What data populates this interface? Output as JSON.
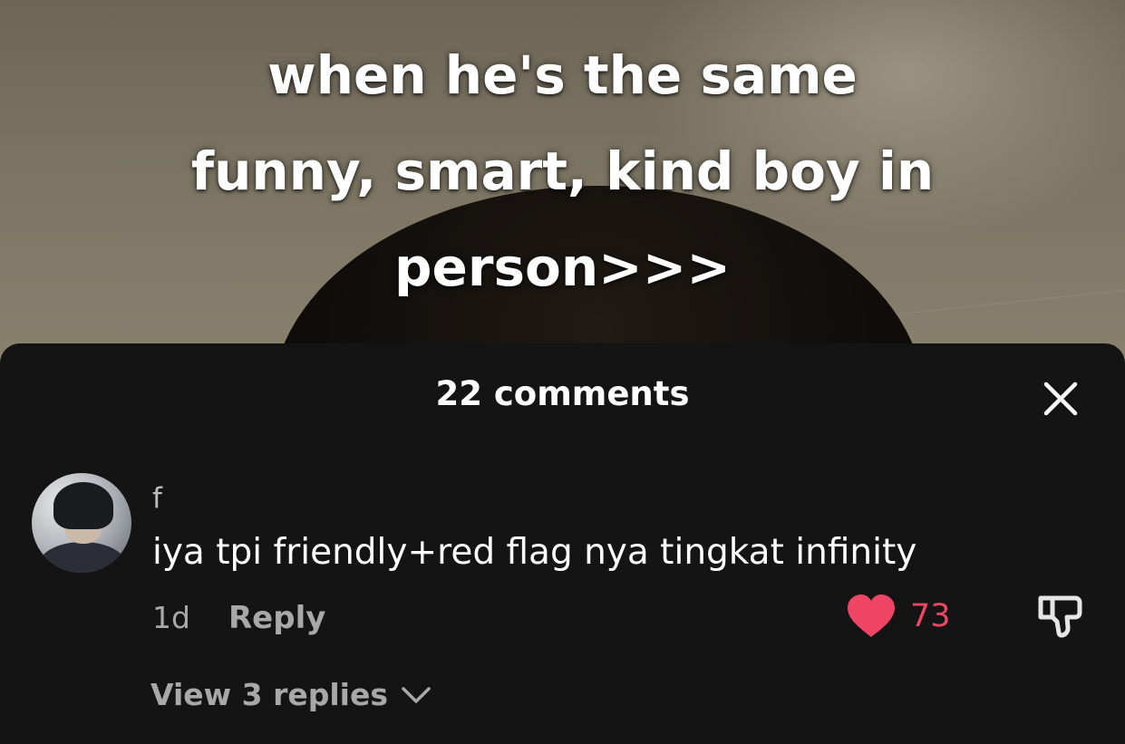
{
  "video": {
    "caption_lines": [
      "when he's the same",
      "funny, smart, kind boy in",
      "person>>>"
    ]
  },
  "comments_panel": {
    "title": "22 comments",
    "close_icon": "close-icon",
    "comment": {
      "avatar_icon": "avatar-image",
      "username": "f",
      "text": "iya tpi friendly+red flag nya tingkat infinity",
      "timestamp": "1d",
      "reply_label": "Reply",
      "like_count": "73",
      "like_color": "#ef4565",
      "liked": true,
      "view_replies_label": "View 3 replies"
    }
  },
  "colors": {
    "sheet_background": "#141414",
    "primary_text": "#ffffff",
    "secondary_text": "#a8a8a8",
    "accent_like": "#ef4565"
  }
}
